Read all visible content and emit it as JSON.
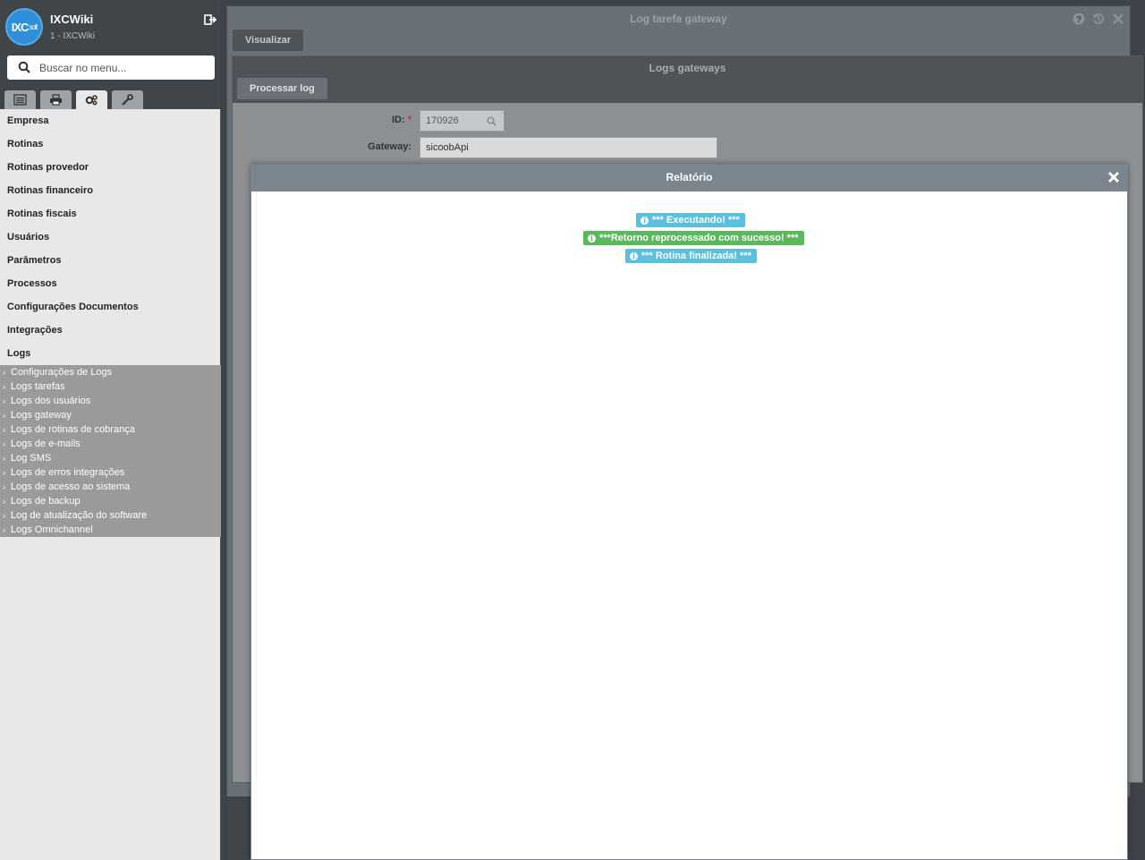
{
  "app": {
    "name": "IXCWiki",
    "subtitle": "1 - IXCWiki",
    "logo_text": "IXC",
    "logo_small": "soft"
  },
  "search": {
    "placeholder": "Buscar no menu..."
  },
  "sidebar_tabs": [
    "list-icon",
    "print-icon",
    "gears-icon",
    "wrench-icon"
  ],
  "menu": {
    "items": [
      "Empresa",
      "Rotinas",
      "Rotinas provedor",
      "Rotinas financeiro",
      "Rotinas fiscais",
      "Usuários",
      "Parâmetros",
      "Processos",
      "Configurações Documentos",
      "Integrações",
      "Logs"
    ],
    "logs_sub": [
      "Configurações de Logs",
      "Logs tarefas",
      "Logs dos usuários",
      "Logs gateway",
      "Logs de rotinas de cobrança",
      "Logs de e-mails",
      "Log SMS",
      "Logs de erros integrações",
      "Logs de acesso ao sistema",
      "Logs de backup",
      "Log de atualização do software",
      "Logs Omnichannel"
    ]
  },
  "outer_window": {
    "title": "Log tarefa gateway",
    "tab": "Visualizar"
  },
  "inner_window": {
    "title": "Logs gateways",
    "button": "Processar log",
    "id_label": "ID:",
    "id_value": "170926",
    "gateway_label": "Gateway:",
    "gateway_value": "sicoobApi"
  },
  "modal": {
    "title": "Relatório",
    "messages": [
      {
        "text": "*** Executando! ***",
        "type": "info"
      },
      {
        "text": "***Retorno reprocessado com sucesso! ***",
        "type": "success"
      },
      {
        "text": "*** Rotina finalizada! ***",
        "type": "info"
      }
    ]
  },
  "colors": {
    "info": "#5bc0de",
    "success": "#5cb85c",
    "header": "#3f4549",
    "modal_header": "#7b858e"
  }
}
